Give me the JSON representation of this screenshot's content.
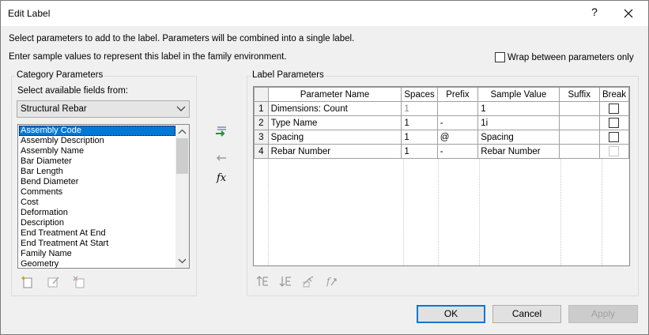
{
  "window": {
    "title": "Edit Label",
    "help_label": "?",
    "close_icon": "close-icon"
  },
  "instructions": {
    "line1": "Select parameters to add to the label.  Parameters will be combined into a single label.",
    "line2": "Enter sample values to represent this label in the family environment.",
    "wrap_label": "Wrap between parameters only",
    "wrap_checked": false
  },
  "category": {
    "group_label": "Category Parameters",
    "select_label": "Select available fields from:",
    "combo_value": "Structural Rebar",
    "items": [
      "Assembly Code",
      "Assembly Description",
      "Assembly Name",
      "Bar Diameter",
      "Bar Length",
      "Bend Diameter",
      "Comments",
      "Cost",
      "Deformation",
      "Description",
      "End Treatment At End",
      "End Treatment At Start",
      "Family Name",
      "Geometry"
    ],
    "selected_index": 0
  },
  "transfer": {
    "add_icon": "add-parameter-icon",
    "remove_icon": "remove-parameter-icon",
    "fx_label": "fx"
  },
  "label_params": {
    "group_label": "Label Parameters",
    "headers": [
      "Parameter Name",
      "Spaces",
      "Prefix",
      "Sample Value",
      "Suffix",
      "Break"
    ],
    "rows": [
      {
        "num": "1",
        "name": "Dimensions: Count",
        "spaces": "1",
        "prefix": "",
        "sample": "1",
        "suffix": "",
        "break_enabled": true
      },
      {
        "num": "2",
        "name": "Type Name",
        "spaces": "1",
        "prefix": "-",
        "sample": "1i",
        "suffix": "",
        "break_enabled": true
      },
      {
        "num": "3",
        "name": "Spacing",
        "spaces": "1",
        "prefix": "@",
        "sample": "Spacing",
        "suffix": "",
        "break_enabled": true
      },
      {
        "num": "4",
        "name": "Rebar Number",
        "spaces": "1",
        "prefix": "-",
        "sample": "Rebar Number",
        "suffix": "",
        "break_enabled": false
      }
    ]
  },
  "buttons": {
    "ok": "OK",
    "cancel": "Cancel",
    "apply": "Apply"
  }
}
